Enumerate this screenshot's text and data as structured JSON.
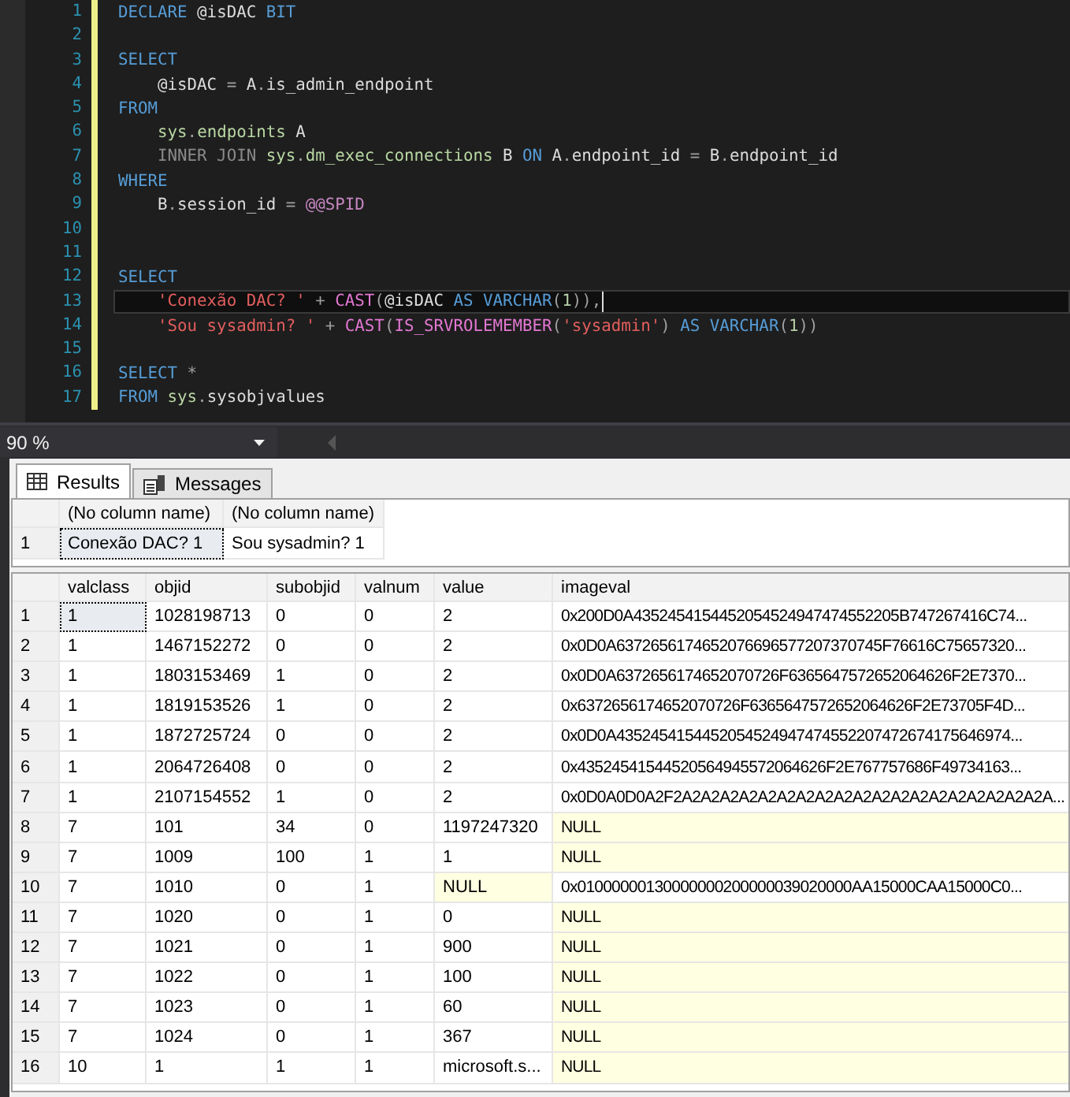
{
  "editor": {
    "lines": [
      {
        "number": "1",
        "current": false,
        "tokens": [
          {
            "kind": "kw",
            "text": "DECLARE"
          },
          {
            "kind": "ident",
            "text": " @isDAC "
          },
          {
            "kind": "kw",
            "text": "BIT"
          }
        ]
      },
      {
        "number": "2",
        "current": false
      },
      {
        "number": "3",
        "current": false,
        "tokens": [
          {
            "kind": "kw",
            "text": "SELECT"
          }
        ]
      },
      {
        "number": "4",
        "current": false,
        "tokens": [
          {
            "kind": "ident",
            "text": "    @isDAC "
          },
          {
            "kind": "op",
            "text": "="
          },
          {
            "kind": "ident",
            "text": " A"
          },
          {
            "kind": "op",
            "text": "."
          },
          {
            "kind": "ident",
            "text": "is_admin_endpoint"
          }
        ]
      },
      {
        "number": "5",
        "current": false,
        "tokens": [
          {
            "kind": "kw",
            "text": "FROM"
          }
        ]
      },
      {
        "number": "6",
        "current": false,
        "tokens": [
          {
            "kind": "sys",
            "text": "    sys"
          },
          {
            "kind": "op",
            "text": "."
          },
          {
            "kind": "sys",
            "text": "endpoints"
          },
          {
            "kind": "ident",
            "text": " A"
          }
        ]
      },
      {
        "number": "7",
        "current": false,
        "tokens": [
          {
            "kind": "join",
            "text": "    INNER JOIN "
          },
          {
            "kind": "sys",
            "text": "sys"
          },
          {
            "kind": "op",
            "text": "."
          },
          {
            "kind": "sys",
            "text": "dm_exec_connections"
          },
          {
            "kind": "ident",
            "text": " B "
          },
          {
            "kind": "kw",
            "text": "ON"
          },
          {
            "kind": "ident",
            "text": " A"
          },
          {
            "kind": "op",
            "text": "."
          },
          {
            "kind": "ident",
            "text": "endpoint_id "
          },
          {
            "kind": "op",
            "text": "="
          },
          {
            "kind": "ident",
            "text": " B"
          },
          {
            "kind": "op",
            "text": "."
          },
          {
            "kind": "ident",
            "text": "endpoint_id"
          }
        ]
      },
      {
        "number": "8",
        "current": false,
        "tokens": [
          {
            "kind": "kw",
            "text": "WHERE"
          }
        ]
      },
      {
        "number": "9",
        "current": false,
        "tokens": [
          {
            "kind": "ident",
            "text": "    B"
          },
          {
            "kind": "op",
            "text": "."
          },
          {
            "kind": "ident",
            "text": "session_id "
          },
          {
            "kind": "op",
            "text": "="
          },
          {
            "kind": "global",
            "text": " @@SPID"
          }
        ]
      },
      {
        "number": "10",
        "current": false
      },
      {
        "number": "11",
        "current": false
      },
      {
        "number": "12",
        "current": false,
        "tokens": [
          {
            "kind": "kw",
            "text": "SELECT"
          }
        ]
      },
      {
        "number": "13",
        "current": true,
        "tokens": [
          {
            "kind": "str",
            "text": "    'Conexão DAC? '"
          },
          {
            "kind": "op",
            "text": " + "
          },
          {
            "kind": "func",
            "text": "CAST"
          },
          {
            "kind": "op",
            "text": "("
          },
          {
            "kind": "ident",
            "text": "@isDAC "
          },
          {
            "kind": "kw",
            "text": "AS VARCHAR"
          },
          {
            "kind": "op",
            "text": "("
          },
          {
            "kind": "num",
            "text": "1"
          },
          {
            "kind": "op",
            "text": ")),"
          }
        ]
      },
      {
        "number": "14",
        "current": false,
        "tokens": [
          {
            "kind": "str",
            "text": "    'Sou sysadmin? '"
          },
          {
            "kind": "op",
            "text": " + "
          },
          {
            "kind": "func",
            "text": "CAST"
          },
          {
            "kind": "op",
            "text": "("
          },
          {
            "kind": "func",
            "text": "IS_SRVROLEMEMBER"
          },
          {
            "kind": "op",
            "text": "("
          },
          {
            "kind": "str",
            "text": "'sysadmin'"
          },
          {
            "kind": "op",
            "text": ") "
          },
          {
            "kind": "kw",
            "text": "AS VARCHAR"
          },
          {
            "kind": "op",
            "text": "("
          },
          {
            "kind": "num",
            "text": "1"
          },
          {
            "kind": "op",
            "text": "))"
          }
        ]
      },
      {
        "number": "15",
        "current": false
      },
      {
        "number": "16",
        "current": false,
        "tokens": [
          {
            "kind": "kw",
            "text": "SELECT"
          },
          {
            "kind": "op",
            "text": " *"
          }
        ]
      },
      {
        "number": "17",
        "current": false,
        "tokens": [
          {
            "kind": "kw",
            "text": "FROM"
          },
          {
            "kind": "sys",
            "text": " sys"
          },
          {
            "kind": "op",
            "text": "."
          },
          {
            "kind": "ident",
            "text": "sysobjvalues"
          }
        ]
      }
    ]
  },
  "zoom": {
    "value": "90 %"
  },
  "results": {
    "tabs": [
      {
        "label": "Results",
        "selected": true,
        "kind": "grid"
      },
      {
        "label": "Messages",
        "selected": false,
        "kind": "messages"
      }
    ],
    "grids": [
      {
        "columns": [
          "(No column name)",
          "(No column name)"
        ],
        "rows": [
          {
            "number": "1",
            "focused": true,
            "cells": [
              "Conexão DAC? 1",
              "Sou sysadmin? 1"
            ],
            "null": [
              false,
              false
            ]
          }
        ]
      },
      {
        "columns": [
          "valclass",
          "objid",
          "subobjid",
          "valnum",
          "value",
          "imageval"
        ],
        "rows": [
          {
            "number": "1",
            "focused": true,
            "cells": [
              "1",
              "1028198713",
              "0",
              "0",
              "2",
              "0x200D0A4352454154452054524947474552205B747267416C74..."
            ],
            "null": [
              false,
              false,
              false,
              false,
              false,
              false
            ]
          },
          {
            "number": "2",
            "focused": false,
            "cells": [
              "1",
              "1467152272",
              "0",
              "0",
              "2",
              "0x0D0A6372656174652076696577207370745F76616C75657320..."
            ],
            "null": [
              false,
              false,
              false,
              false,
              false,
              false
            ]
          },
          {
            "number": "3",
            "focused": false,
            "cells": [
              "1",
              "1803153469",
              "1",
              "0",
              "2",
              "0x0D0A6372656174652070726F6365647572652064626F2E7370..."
            ],
            "null": [
              false,
              false,
              false,
              false,
              false,
              false
            ]
          },
          {
            "number": "4",
            "focused": false,
            "cells": [
              "1",
              "1819153526",
              "1",
              "0",
              "2",
              "0x6372656174652070726F6365647572652064626F2E73705F4D..."
            ],
            "null": [
              false,
              false,
              false,
              false,
              false,
              false
            ]
          },
          {
            "number": "5",
            "focused": false,
            "cells": [
              "1",
              "1872725724",
              "0",
              "0",
              "2",
              "0x0D0A4352454154452054524947474552207472674175646974..."
            ],
            "null": [
              false,
              false,
              false,
              false,
              false,
              false
            ]
          },
          {
            "number": "6",
            "focused": false,
            "cells": [
              "1",
              "2064726408",
              "0",
              "0",
              "2",
              "0x43524541544520564945572064626F2E767757686F49734163..."
            ],
            "null": [
              false,
              false,
              false,
              false,
              false,
              false
            ]
          },
          {
            "number": "7",
            "focused": false,
            "cells": [
              "1",
              "2107154552",
              "1",
              "0",
              "2",
              "0x0D0A0D0A2F2A2A2A2A2A2A2A2A2A2A2A2A2A2A2A2A2A2A2A2A..."
            ],
            "null": [
              false,
              false,
              false,
              false,
              false,
              false
            ]
          },
          {
            "number": "8",
            "focused": false,
            "cells": [
              "7",
              "101",
              "34",
              "0",
              "1197247320",
              "NULL"
            ],
            "null": [
              false,
              false,
              false,
              false,
              false,
              true
            ]
          },
          {
            "number": "9",
            "focused": false,
            "cells": [
              "7",
              "1009",
              "100",
              "1",
              "1",
              "NULL"
            ],
            "null": [
              false,
              false,
              false,
              false,
              false,
              true
            ]
          },
          {
            "number": "10",
            "focused": false,
            "cells": [
              "7",
              "1010",
              "0",
              "1",
              "NULL",
              "0x01000000130000000200000039020000AA15000CAA15000C0..."
            ],
            "null": [
              false,
              false,
              false,
              false,
              true,
              false
            ]
          },
          {
            "number": "11",
            "focused": false,
            "cells": [
              "7",
              "1020",
              "0",
              "1",
              "0",
              "NULL"
            ],
            "null": [
              false,
              false,
              false,
              false,
              false,
              true
            ]
          },
          {
            "number": "12",
            "focused": false,
            "cells": [
              "7",
              "1021",
              "0",
              "1",
              "900",
              "NULL"
            ],
            "null": [
              false,
              false,
              false,
              false,
              false,
              true
            ]
          },
          {
            "number": "13",
            "focused": false,
            "cells": [
              "7",
              "1022",
              "0",
              "1",
              "100",
              "NULL"
            ],
            "null": [
              false,
              false,
              false,
              false,
              false,
              true
            ]
          },
          {
            "number": "14",
            "focused": false,
            "cells": [
              "7",
              "1023",
              "0",
              "1",
              "60",
              "NULL"
            ],
            "null": [
              false,
              false,
              false,
              false,
              false,
              true
            ]
          },
          {
            "number": "15",
            "focused": false,
            "cells": [
              "7",
              "1024",
              "0",
              "1",
              "367",
              "NULL"
            ],
            "null": [
              false,
              false,
              false,
              false,
              false,
              true
            ]
          },
          {
            "number": "16",
            "focused": false,
            "cells": [
              "10",
              "1",
              "1",
              "1",
              "microsoft.s...",
              "NULL"
            ],
            "null": [
              false,
              false,
              false,
              false,
              false,
              true
            ]
          }
        ]
      }
    ]
  }
}
